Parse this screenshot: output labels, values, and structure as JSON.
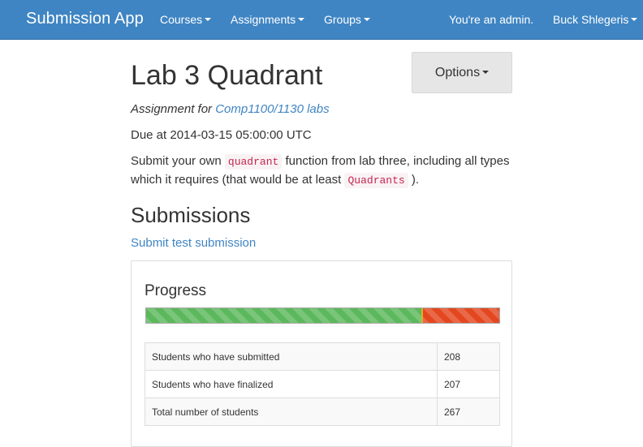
{
  "navbar": {
    "brand": "Submission App",
    "menus": [
      {
        "label": "Courses"
      },
      {
        "label": "Assignments"
      },
      {
        "label": "Groups"
      }
    ],
    "admin_text": "You're an admin.",
    "user_name": "Buck Shlegeris"
  },
  "assignment": {
    "title": "Lab 3 Quadrant",
    "options_label": "Options",
    "for_prefix": "Assignment for",
    "course_link": "Comp1100/1130 labs",
    "due": "Due at 2014-03-15 05:00:00 UTC",
    "description": {
      "part1": "Submit your own",
      "code1": "quadrant",
      "part2": "function from lab three, including all types which it requires (that would be at least",
      "code2": "Quadrants",
      "part3": ")."
    }
  },
  "submissions": {
    "heading": "Submissions",
    "submit_link": "Submit test submission",
    "progress": {
      "title": "Progress",
      "submitted_fraction": 0.779,
      "colors": {
        "success": "#5cb85c",
        "danger": "#e4471f"
      }
    },
    "stats": [
      {
        "label": "Students who have submitted",
        "value": "208"
      },
      {
        "label": "Students who have finalized",
        "value": "207"
      },
      {
        "label": "Total number of students",
        "value": "267"
      }
    ]
  }
}
